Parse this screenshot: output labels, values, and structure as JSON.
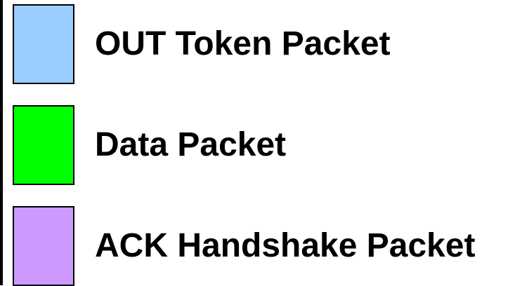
{
  "legend": {
    "items": [
      {
        "label": "OUT Token Packet",
        "color": "#99ccff"
      },
      {
        "label": "Data Packet",
        "color": "#00ff00"
      },
      {
        "label": "ACK Handshake Packet",
        "color": "#cc99ff"
      }
    ]
  }
}
